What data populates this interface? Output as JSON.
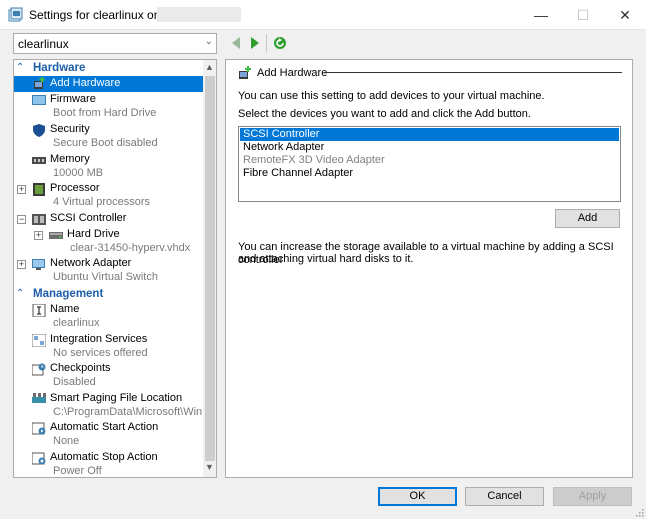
{
  "window": {
    "title": "Settings for clearlinux on DE",
    "min_glyph": "—",
    "max_glyph": "☐",
    "close_glyph": "✕"
  },
  "toolbar": {
    "vm_select": "clearlinux",
    "icons": [
      "back-arrow-icon",
      "forward-arrow-icon",
      "refresh-icon"
    ]
  },
  "sidebar": {
    "sections": [
      {
        "label": "Hardware"
      },
      {
        "label": "Management"
      }
    ],
    "items": [
      {
        "primary": "Add Hardware",
        "secondary": "",
        "icon": "add-hardware-icon",
        "selected": true
      },
      {
        "primary": "Firmware",
        "secondary": "Boot from Hard Drive",
        "icon": "firmware-icon"
      },
      {
        "primary": "Security",
        "secondary": "Secure Boot disabled",
        "icon": "shield-icon"
      },
      {
        "primary": "Memory",
        "secondary": "10000 MB",
        "icon": "memory-icon"
      },
      {
        "primary": "Processor",
        "secondary": "4 Virtual processors",
        "icon": "processor-icon",
        "expander": "+"
      },
      {
        "primary": "SCSI Controller",
        "secondary": "",
        "icon": "scsi-controller-icon",
        "expander": "−"
      },
      {
        "primary": "Hard Drive",
        "secondary": "clear-31450-hyperv.vhdx",
        "icon": "hard-drive-icon",
        "expander": "+"
      },
      {
        "primary": "Network Adapter",
        "secondary": "Ubuntu Virtual Switch",
        "icon": "network-adapter-icon",
        "expander": "+"
      },
      {
        "primary": "Name",
        "secondary": "clearlinux",
        "icon": "name-icon"
      },
      {
        "primary": "Integration Services",
        "secondary": "No services offered",
        "icon": "integration-services-icon"
      },
      {
        "primary": "Checkpoints",
        "secondary": "Disabled",
        "icon": "checkpoints-icon"
      },
      {
        "primary": "Smart Paging File Location",
        "secondary": "C:\\ProgramData\\Microsoft\\Win...",
        "icon": "smart-paging-icon"
      },
      {
        "primary": "Automatic Start Action",
        "secondary": "None",
        "icon": "auto-start-icon"
      },
      {
        "primary": "Automatic Stop Action",
        "secondary": "Power Off",
        "icon": "auto-stop-icon"
      }
    ]
  },
  "main": {
    "heading": "Add Hardware",
    "intro": "You can use this setting to add devices to your virtual machine.",
    "select_prompt": "Select the devices you want to add and click the Add button.",
    "devices": [
      {
        "label": "SCSI Controller",
        "state": "selected"
      },
      {
        "label": "Network Adapter",
        "state": "normal"
      },
      {
        "label": "RemoteFX 3D Video Adapter",
        "state": "disabled"
      },
      {
        "label": "Fibre Channel Adapter",
        "state": "normal"
      }
    ],
    "add_label": "Add",
    "info_line1": "You can increase the storage available to a virtual machine by adding a SCSI controller",
    "info_line2": "and attaching virtual hard disks to it."
  },
  "footer": {
    "ok_label": "OK",
    "cancel_label": "Cancel",
    "apply_label": "Apply"
  },
  "colors": {
    "selection": "#0078d7",
    "section_heading": "#1d5ea8",
    "secondary_text": "#7a7a7a"
  }
}
